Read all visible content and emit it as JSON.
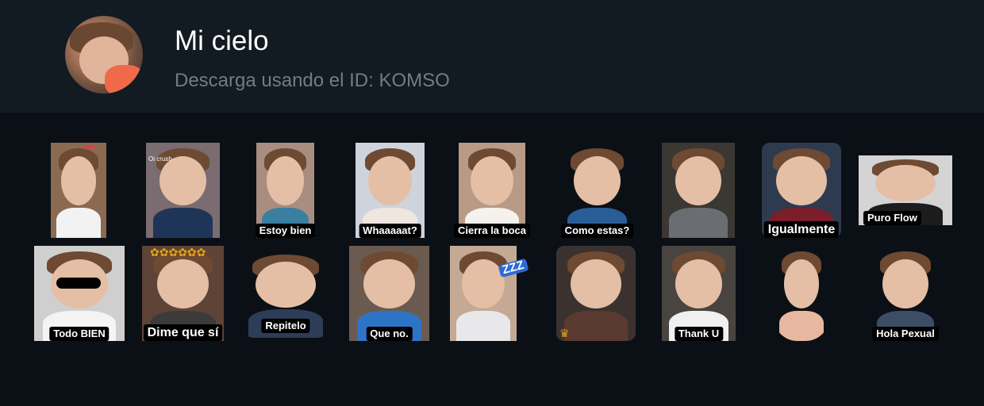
{
  "pack": {
    "title": "Mi cielo",
    "subtitle": "Descarga usando el ID: KOMSO"
  },
  "stickers": [
    {
      "name": "sticker-1",
      "caption": "",
      "tag": "",
      "bg": "#8a6a50",
      "body": "#f2f2f2"
    },
    {
      "name": "sticker-2",
      "caption": "",
      "tag": "Oi crush",
      "bg": "#7a6c70",
      "body": "#1f3558"
    },
    {
      "name": "sticker-3",
      "caption": "Estoy bien",
      "tag": "",
      "bg": "#a88d80",
      "body": "#3a7fa0"
    },
    {
      "name": "sticker-4",
      "caption": "Whaaaaat?",
      "tag": "",
      "bg": "#cfd3dc",
      "body": "#efe6df"
    },
    {
      "name": "sticker-5",
      "caption": "Cierra la boca",
      "tag": "",
      "bg": "#b89a86",
      "body": "#f5f2ee"
    },
    {
      "name": "sticker-6",
      "caption": "Como estas?",
      "tag": "",
      "bg": "#0b1016",
      "body": "#2a5d96"
    },
    {
      "name": "sticker-7",
      "caption": "",
      "tag": "",
      "bg": "#3b3733",
      "body": "#6a6e72"
    },
    {
      "name": "sticker-8",
      "caption": "Igualmente",
      "tag": "",
      "bg": "#2e3a4e",
      "body": "#7a1e2a"
    },
    {
      "name": "sticker-9",
      "caption": "Puro Flow",
      "tag": "",
      "bg": "#d4d4d4",
      "body": "#1c1c1c"
    },
    {
      "name": "sticker-10",
      "caption": "Todo BIEN",
      "tag": "",
      "bg": "#cfcfcf",
      "body": "#f4f4f4"
    },
    {
      "name": "sticker-11",
      "caption": "Dime que sí",
      "tag": "",
      "bg": "#5e4436",
      "body": "#3d3a3a"
    },
    {
      "name": "sticker-12",
      "caption": "Repitelo",
      "tag": "",
      "bg": "#0b1016",
      "body": "#2d3c57"
    },
    {
      "name": "sticker-13",
      "caption": "Que no.",
      "tag": "",
      "bg": "#6b5a50",
      "body": "#2d74c6"
    },
    {
      "name": "sticker-14",
      "caption": "",
      "tag": "ZZZ",
      "bg": "#c4a995",
      "body": "#e8e8ea"
    },
    {
      "name": "sticker-15",
      "caption": "",
      "tag": "",
      "bg": "#3b3230",
      "body": "#5a3a30"
    },
    {
      "name": "sticker-16",
      "caption": "Thank U",
      "tag": "",
      "bg": "#4a4440",
      "body": "#f0f0f0"
    },
    {
      "name": "sticker-17",
      "caption": "",
      "tag": "",
      "bg": "#0b1016",
      "body": "#e8b79f"
    },
    {
      "name": "sticker-18",
      "caption": "Hola Pexual",
      "tag": "",
      "bg": "#0b1016",
      "body": "#3c4e66"
    }
  ],
  "colors": {
    "background": "#0b1016",
    "header": "#121a22",
    "title": "#ffffff",
    "subtitle": "#757b82"
  }
}
